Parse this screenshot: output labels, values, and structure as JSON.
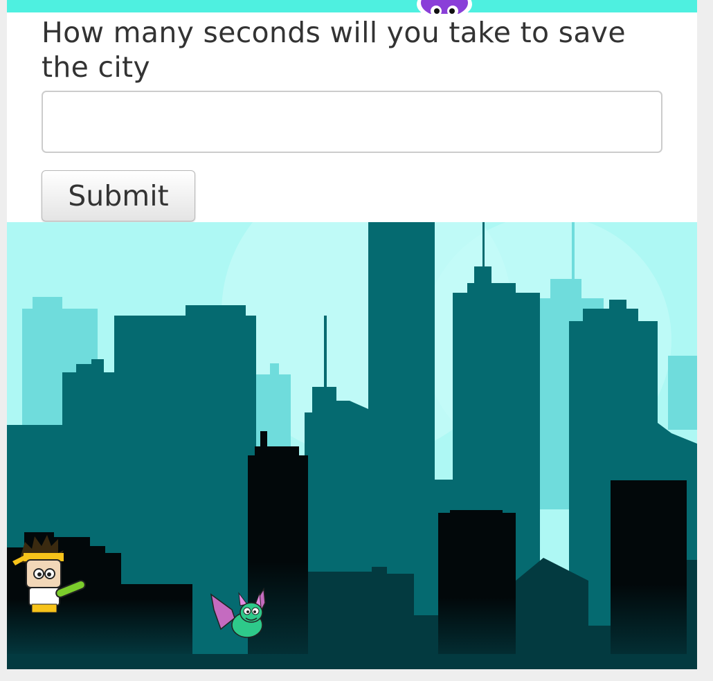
{
  "quiz": {
    "question": "How many seconds will you take to save the city",
    "answer_value": "",
    "answer_placeholder": "",
    "submit_label": "Submit"
  },
  "colors": {
    "banner": "#4ef0e0",
    "sky": "#aef8f4",
    "far_buildings": "#6fdcdc",
    "mid_buildings": "#056a70",
    "near_buildings": "#02080a",
    "ground": "#033a40"
  },
  "characters": {
    "hero": "ninja-hero-character",
    "enemy": "bat-creature-character",
    "mascot": "purple-monster-mascot"
  }
}
